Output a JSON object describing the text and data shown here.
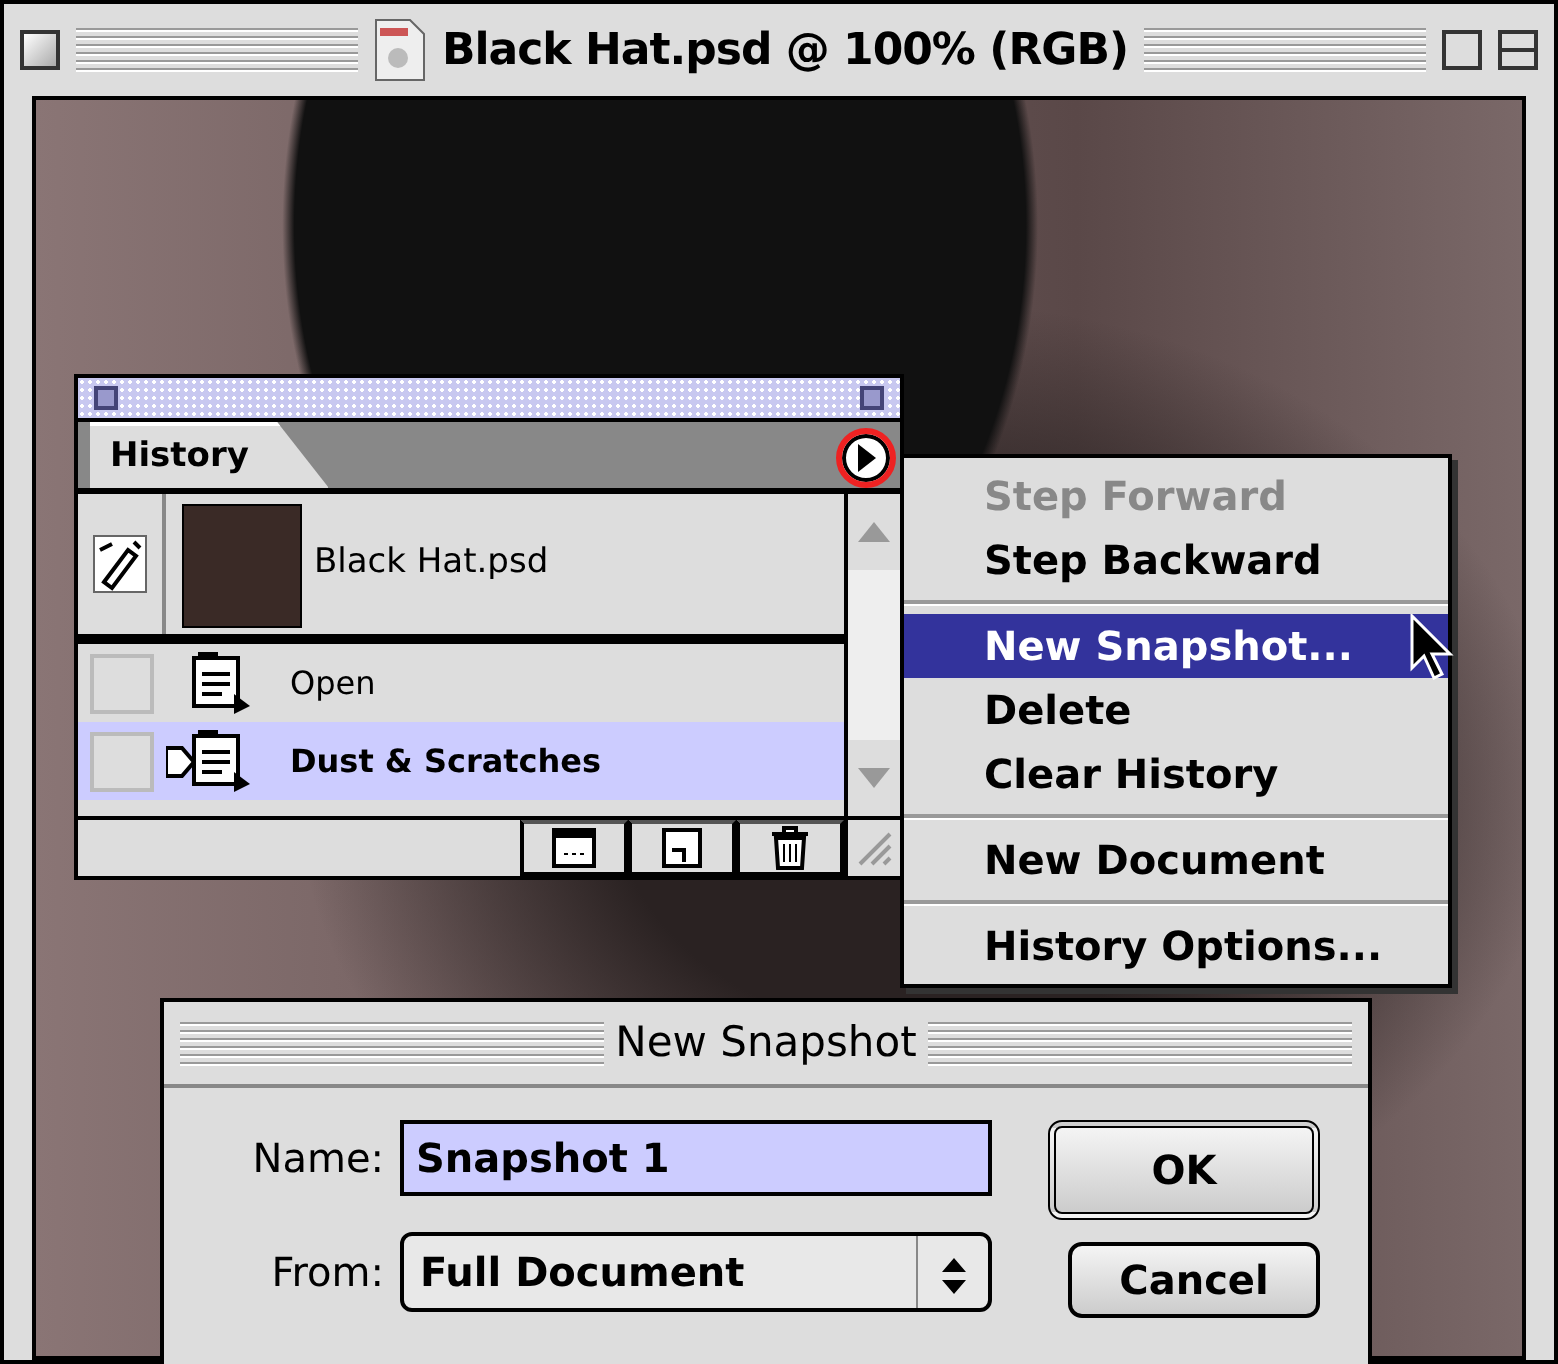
{
  "window": {
    "title": "Black Hat.psd @ 100% (RGB)"
  },
  "history_palette": {
    "tab": "History",
    "snapshot": {
      "name": "Black Hat.psd",
      "source": true
    },
    "states": [
      {
        "name": "Open",
        "selected": false
      },
      {
        "name": "Dust & Scratches",
        "selected": true
      }
    ]
  },
  "palette_menu": {
    "groups": [
      [
        {
          "label": "Step Forward",
          "disabled": true,
          "selected": false
        },
        {
          "label": "Step Backward",
          "disabled": false,
          "selected": false
        }
      ],
      [
        {
          "label": "New Snapshot...",
          "disabled": false,
          "selected": true
        },
        {
          "label": "Delete",
          "disabled": false,
          "selected": false
        },
        {
          "label": "Clear History",
          "disabled": false,
          "selected": false
        }
      ],
      [
        {
          "label": "New Document",
          "disabled": false,
          "selected": false
        }
      ],
      [
        {
          "label": "History Options...",
          "disabled": false,
          "selected": false
        }
      ]
    ]
  },
  "dialog": {
    "title": "New Snapshot",
    "name_label": "Name:",
    "name_value": "Snapshot 1",
    "from_label": "From:",
    "from_value": "Full Document",
    "buttons": [
      {
        "label": "OK",
        "default": true
      },
      {
        "label": "Cancel",
        "default": false
      }
    ]
  }
}
